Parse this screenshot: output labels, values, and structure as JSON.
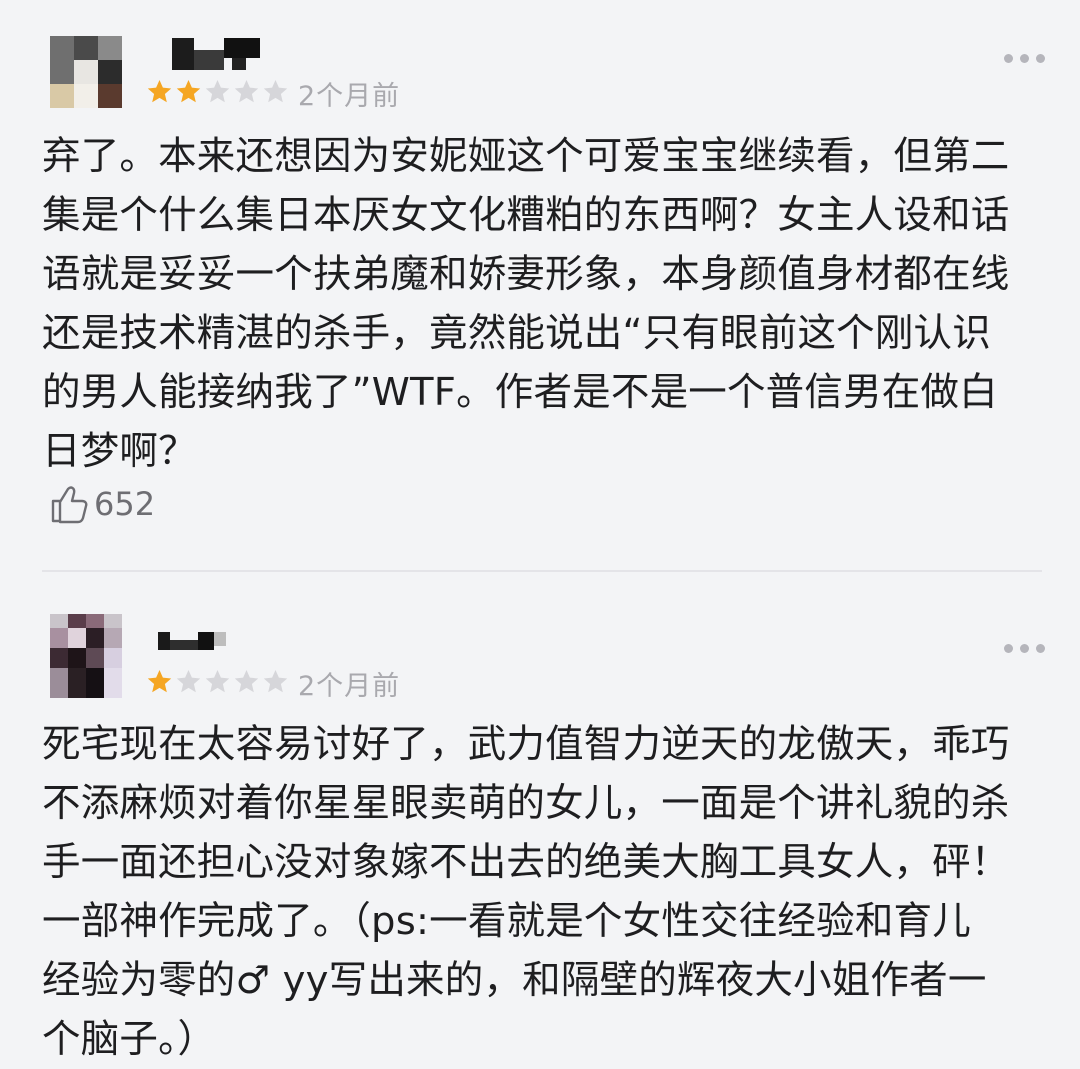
{
  "reviews": [
    {
      "rating": 2,
      "max_rating": 5,
      "time": "2个月前",
      "lines": [
        "弃了。本来还想因为安妮娅这个可爱宝宝继续看，但第二",
        "集是个什么集日本厌女文化糟粕的东西啊？女主人设和话",
        "语就是妥妥一个扶弟魔和娇妻形象，本身颜值身材都在线",
        "还是技术精湛的杀手，竟然能说出“只有眼前这个刚认识",
        "的男人能接纳我了”WTF。作者是不是一个普信男在做白",
        "日梦啊？"
      ],
      "likes": "652"
    },
    {
      "rating": 1,
      "max_rating": 5,
      "time": "2个月前",
      "lines": [
        "死宅现在太容易讨好了，武力值智力逆天的龙傲天，乖巧",
        "不添麻烦对着你星星眼卖萌的女儿，一面是个讲礼貌的杀",
        "手一面还担心没对象嫁不出去的绝美大胸工具女人，砰！",
        "一部神作完成了。（ps:一看就是个女性交往经验和育儿",
        "经验为零的♂ yy写出来的，和隔壁的辉夜大小姐作者一",
        "个脑子。）"
      ]
    }
  ],
  "icons": {
    "star_filled": "star-filled-icon",
    "star_empty": "star-empty-icon",
    "more": "more-dots-icon",
    "like": "thumbs-up-icon"
  },
  "colors": {
    "background": "#f3f4f6",
    "star_filled": "#f5a623",
    "star_empty": "#d6d6da",
    "meta_text": "#a9a9ae",
    "body_text": "#1e1e20"
  }
}
